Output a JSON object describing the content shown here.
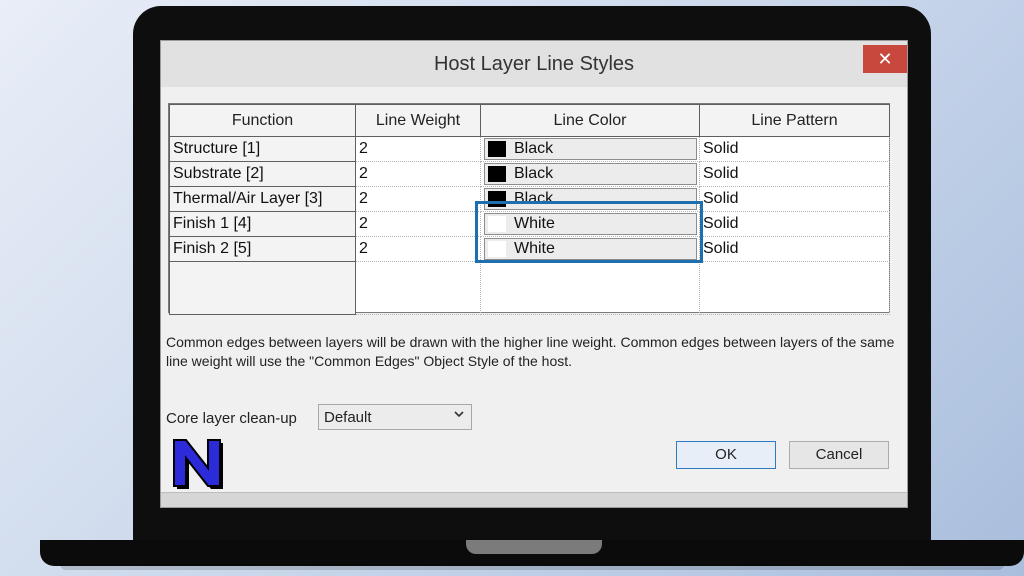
{
  "dialog": {
    "title": "Host Layer Line Styles",
    "close_glyph": "✕"
  },
  "table": {
    "headers": [
      "Function",
      "Line Weight",
      "Line Color",
      "Line Pattern"
    ],
    "rows": [
      {
        "function": "Structure [1]",
        "weight": "2",
        "color": "Black",
        "color_hex": "#000000",
        "pattern": "Solid"
      },
      {
        "function": "Substrate [2]",
        "weight": "2",
        "color": "Black",
        "color_hex": "#000000",
        "pattern": "Solid"
      },
      {
        "function": "Thermal/Air Layer [3]",
        "weight": "2",
        "color": "Black",
        "color_hex": "#000000",
        "pattern": "Solid"
      },
      {
        "function": "Finish 1 [4]",
        "weight": "2",
        "color": "White",
        "color_hex": "#ffffff",
        "pattern": "Solid"
      },
      {
        "function": "Finish 2 [5]",
        "weight": "2",
        "color": "White",
        "color_hex": "#ffffff",
        "pattern": "Solid"
      }
    ]
  },
  "note": "Common edges between layers will be drawn with the higher line weight.  Common edges between layers of the same line weight will use the \"Common Edges\" Object Style of the host.",
  "cleanup": {
    "label": "Core layer clean-up",
    "value": "Default"
  },
  "buttons": {
    "ok": "OK",
    "cancel": "Cancel"
  },
  "logo": {
    "letter": "N",
    "fill": "#2b2bd9",
    "outline": "#000000"
  },
  "colors": {
    "highlight": "#1e6fb0",
    "close_button": "#c9483d"
  }
}
